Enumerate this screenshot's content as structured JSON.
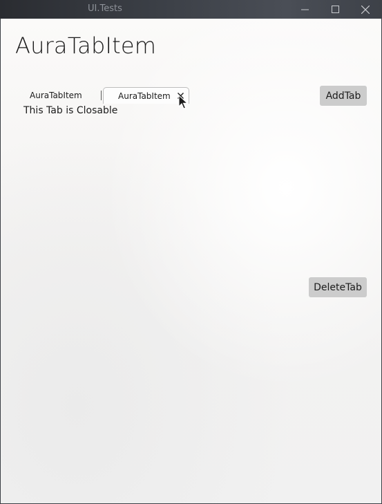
{
  "window": {
    "title": "UI.Tests",
    "controls": [
      "minimize-icon",
      "maximize-icon",
      "close-icon"
    ]
  },
  "page": {
    "title": "AuraTabItem"
  },
  "tabs": [
    {
      "label": "AuraTabItem",
      "selected": false,
      "closable": false
    },
    {
      "label": "AuraTabItem",
      "selected": true,
      "closable": true,
      "close_glyph": "✕"
    }
  ],
  "tab_content": {
    "text": "This Tab is Closable"
  },
  "buttons": {
    "add_label": "AddTab",
    "delete_label": "DeleteTab"
  },
  "colors": {
    "button_bg": "#cccccc",
    "text": "#1b1b1b",
    "titlebar": "#3b3f46"
  }
}
